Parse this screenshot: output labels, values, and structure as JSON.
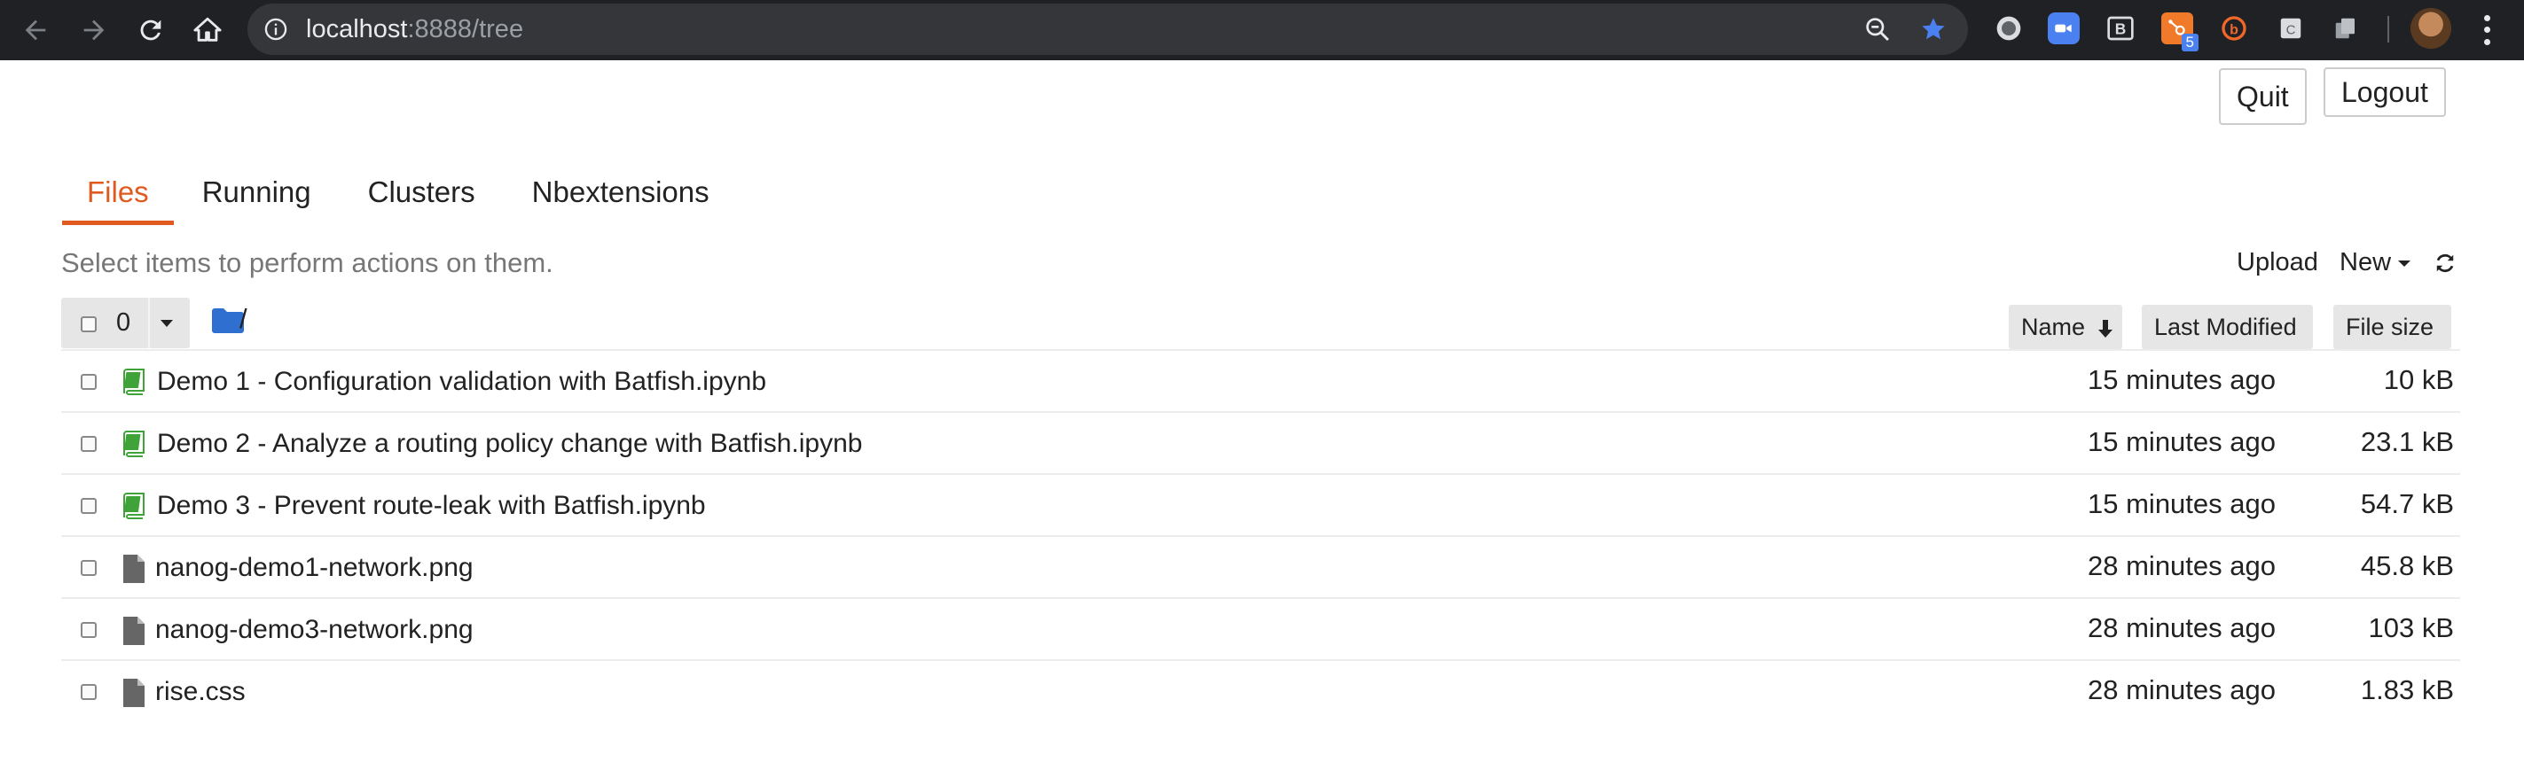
{
  "browser": {
    "url_host": "localhost",
    "url_rest": ":8888/tree",
    "extensions": [
      {
        "name": "github-icon",
        "color": "#9aa0a6"
      },
      {
        "name": "zoom-icon",
        "color": "#4a80f0"
      },
      {
        "name": "b-icon",
        "color": "#dadce0"
      },
      {
        "name": "hubspot-icon",
        "color": "#f07a2a",
        "badge": "5"
      },
      {
        "name": "b-orange-icon",
        "color": "#f0672a"
      },
      {
        "name": "c-icon",
        "color": "#dadce0"
      },
      {
        "name": "copy-icon",
        "color": "#9aa0a6"
      }
    ],
    "accent": "#4a80f0"
  },
  "header": {
    "quit_label": "Quit",
    "logout_label": "Logout"
  },
  "tabs": [
    {
      "label": "Files",
      "active": true
    },
    {
      "label": "Running",
      "active": false
    },
    {
      "label": "Clusters",
      "active": false
    },
    {
      "label": "Nbextensions",
      "active": false
    }
  ],
  "toolbar": {
    "hint": "Select items to perform actions on them.",
    "upload_label": "Upload",
    "new_label": "New"
  },
  "list_header": {
    "selected_count": "0",
    "path": "/",
    "sort_name": "Name",
    "sort_modified": "Last Modified",
    "sort_size": "File size"
  },
  "files": [
    {
      "name": "Demo 1 - Configuration validation with Batfish.ipynb",
      "modified": "15 minutes ago",
      "size": "10 kB",
      "kind": "notebook"
    },
    {
      "name": "Demo 2 - Analyze a routing policy change with Batfish.ipynb",
      "modified": "15 minutes ago",
      "size": "23.1 kB",
      "kind": "notebook"
    },
    {
      "name": "Demo 3 - Prevent route-leak with Batfish.ipynb",
      "modified": "15 minutes ago",
      "size": "54.7 kB",
      "kind": "notebook"
    },
    {
      "name": "nanog-demo1-network.png",
      "modified": "28 minutes ago",
      "size": "45.8 kB",
      "kind": "file"
    },
    {
      "name": "nanog-demo3-network.png",
      "modified": "28 minutes ago",
      "size": "103 kB",
      "kind": "file"
    },
    {
      "name": "rise.css",
      "modified": "28 minutes ago",
      "size": "1.83 kB",
      "kind": "file"
    }
  ],
  "colors": {
    "tab_active": "#e05a1f",
    "notebook_icon": "#3fa33a",
    "file_icon": "#666666",
    "folder_icon": "#2f6fd0"
  }
}
